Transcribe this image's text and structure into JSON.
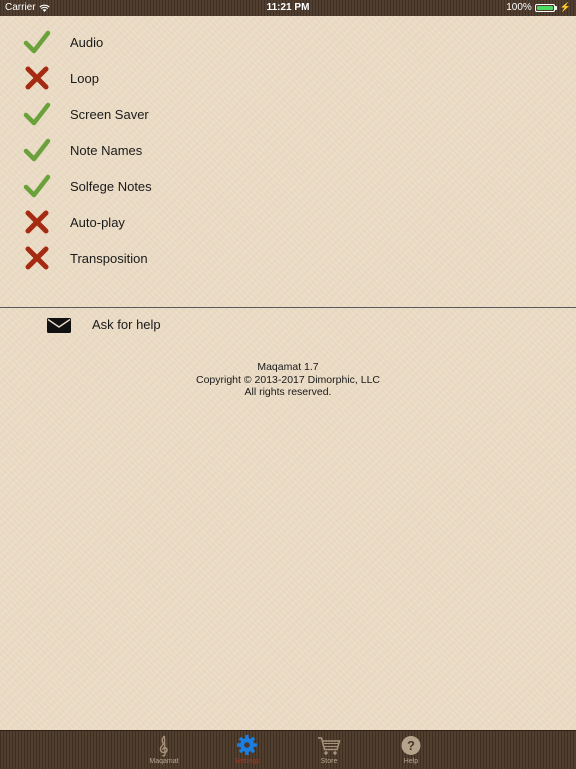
{
  "status_bar": {
    "carrier": "Carrier",
    "time": "11:21 PM",
    "battery": "100%"
  },
  "settings": [
    {
      "label": "Audio",
      "enabled": true
    },
    {
      "label": "Loop",
      "enabled": false
    },
    {
      "label": "Screen Saver",
      "enabled": true
    },
    {
      "label": "Note Names",
      "enabled": true
    },
    {
      "label": "Solfege Notes",
      "enabled": true
    },
    {
      "label": "Auto-play",
      "enabled": false
    },
    {
      "label": "Transposition",
      "enabled": false
    }
  ],
  "help": {
    "label": "Ask for help",
    "icon": "envelope-icon"
  },
  "about": {
    "version": "Maqamat 1.7",
    "copyright": "Copyright © 2013-2017 Dimorphic, LLC",
    "rights": "All rights reserved."
  },
  "tabs": [
    {
      "label": "Maqamat",
      "icon": "treble-clef-icon",
      "active": false
    },
    {
      "label": "Settings",
      "icon": "gear-icon",
      "active": true
    },
    {
      "label": "Store",
      "icon": "cart-icon",
      "active": false
    },
    {
      "label": "Help",
      "icon": "question-icon",
      "active": false
    }
  ],
  "colors": {
    "check": "#6aa13a",
    "cross": "#a52a12",
    "active_tab_icon": "#1a7fe0",
    "active_tab_label": "#b6331c",
    "inactive_tab": "#b7a690"
  }
}
